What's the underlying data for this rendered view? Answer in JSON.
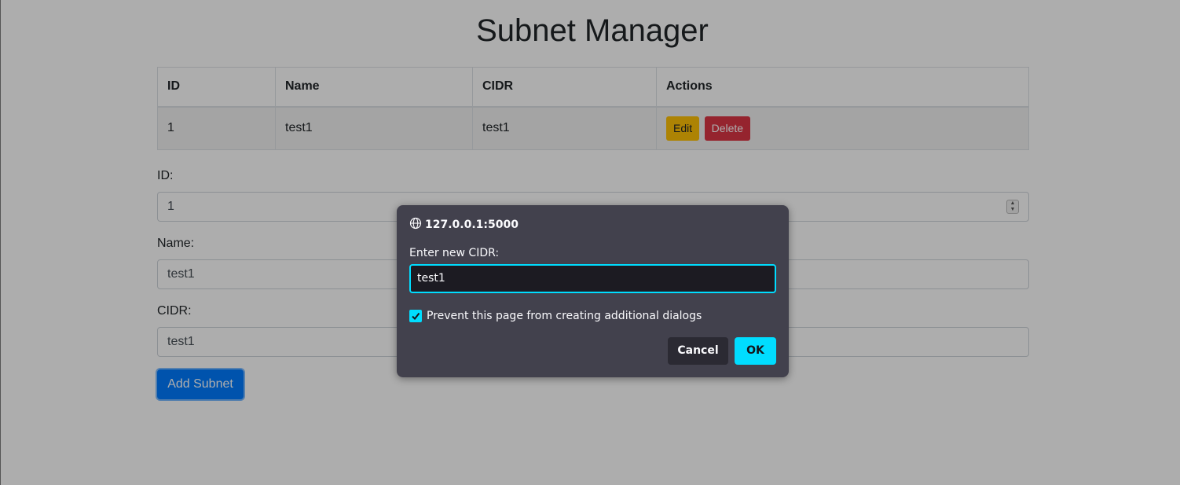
{
  "page": {
    "title": "Subnet Manager"
  },
  "table": {
    "headers": [
      "ID",
      "Name",
      "CIDR",
      "Actions"
    ],
    "rows": [
      {
        "id": "1",
        "name": "test1",
        "cidr": "test1",
        "edit_label": "Edit",
        "delete_label": "Delete"
      }
    ]
  },
  "form": {
    "id_label": "ID:",
    "id_value": "1",
    "name_label": "Name:",
    "name_value": "test1",
    "cidr_label": "CIDR:",
    "cidr_value": "test1",
    "submit_label": "Add Subnet"
  },
  "dialog": {
    "origin": "127.0.0.1:5000",
    "prompt": "Enter new CIDR:",
    "input_value": "test1",
    "checkbox_label": "Prevent this page from creating additional dialogs",
    "checkbox_checked": true,
    "cancel_label": "Cancel",
    "ok_label": "OK"
  },
  "colors": {
    "edit_button": "#ffc107",
    "delete_button": "#dc3545",
    "primary_button": "#007bff",
    "dialog_accent": "#00ddff",
    "dialog_background": "#42414d"
  },
  "icons": {
    "dialog_origin": "globe-icon",
    "checkbox": "checkmark-icon"
  }
}
